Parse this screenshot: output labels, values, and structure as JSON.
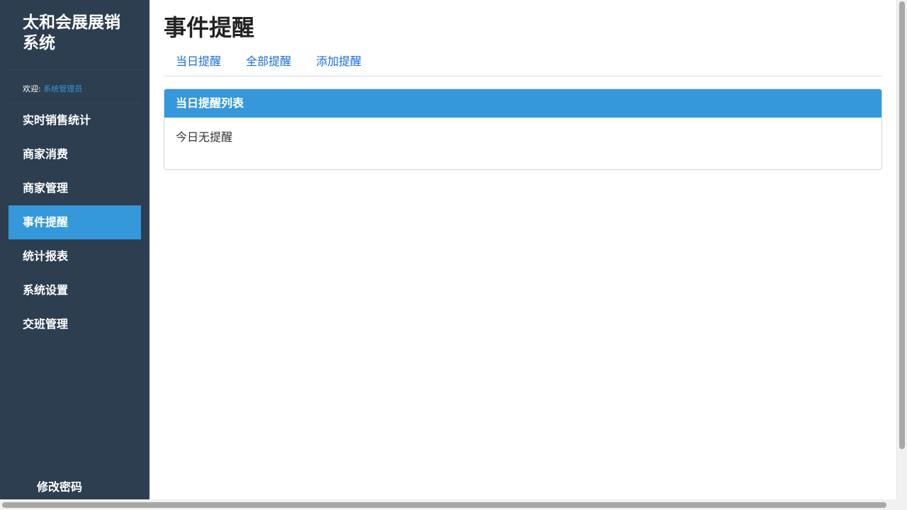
{
  "sidebar": {
    "brand": "太和会展展销系统",
    "welcome_label": "欢迎: ",
    "welcome_user": "系统管理员",
    "items": [
      {
        "label": "实时销售统计"
      },
      {
        "label": "商家消费"
      },
      {
        "label": "商家管理"
      },
      {
        "label": "事件提醒",
        "active": true
      },
      {
        "label": "统计报表"
      },
      {
        "label": "系统设置"
      },
      {
        "label": "交班管理"
      }
    ],
    "change_password": "修改密码"
  },
  "main": {
    "title": "事件提醒",
    "tabs": [
      {
        "label": "当日提醒"
      },
      {
        "label": "全部提醒"
      },
      {
        "label": "添加提醒"
      }
    ],
    "panel": {
      "heading": "当日提醒列表",
      "body": "今日无提醒"
    }
  },
  "colors": {
    "sidebar_bg": "#2c3e50",
    "accent": "#3498db",
    "link": "#1a6fd6"
  }
}
